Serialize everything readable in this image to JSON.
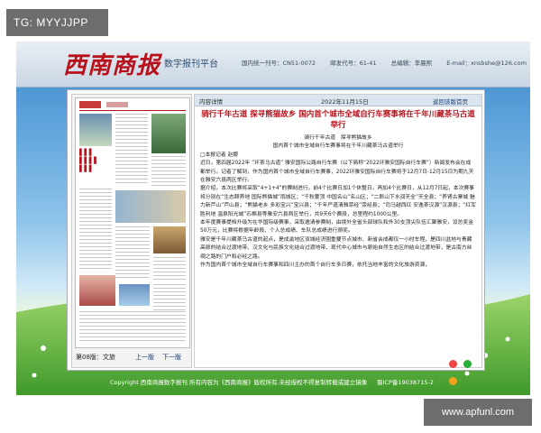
{
  "watermark_tag": "TG: MYYJJPP",
  "watermark_url": "www.apfunl.com",
  "header": {
    "logo": "西南商报",
    "platform": "数字报刊平台",
    "issn": "国内统一刊号：CN51-0072",
    "postal": "邮发代号：61-41",
    "editor": "总编辑：李晨熙",
    "email": "E-mail：xnsbshe@126.com"
  },
  "thumb": {
    "page_label": "第08版：文旅",
    "prev": "上一版",
    "next": "下一版"
  },
  "article": {
    "tab": "内容详情",
    "date": "2022年11月15日",
    "back": "返回该版首页",
    "title": "骑行千年古道 探寻熊猫故乡 国内首个城市全域自行车赛事将在千年川藏茶马古道举行",
    "subtitle1": "骑行千年古道　探寻熊猫故乡",
    "subtitle2": "国内首个城市全域自行车赛事将在千年川藏茶马古道举行",
    "byline": "□本报记者 赵娜",
    "paragraphs": [
      "近日，第四届2022年 “环茶马古道” 雅安国际公路自行车赛（以下简称“2022环雅安国际自行车赛”）新闻发布会在成都举行。记者了解到，作为国内首个城市全域自行车赛事，2022环雅安国际自行车赛将于12月7日-12月15日为期九天在雅安六县两区举行。",
      "据介绍，本次比赛将采取“4+1+4”的赛制进行，前4个比赛日加1个休整日，再加4个比赛日，从12月7日起，本次赛事将分别在“生态颐养地 国际熊猫城”雨城区；“千秋蒙顶 中国名山”名山区；“二郎山下水润天全”天全县；“养肾古寨城 魅力新芦山”芦山县；“熊猫老乡 多彩宝兴”宝兴县；“千年严道清雅荥经”荥经县；“司马越西红 安逸茶汉源”汉源县；“红军胜利地 温泉阳光城”石棉县等雅安六县两区举行，共9天6个赛段，总里程约1000公里。",
      "本年度赛事提档升级为在华国际级赛事，采取邀请参赛制，由境外全省头部球队和外30支顶尖队伍汇聚雅安，设总奖金50万元，比赛将根据年龄段、个人总成绩、车队总成绩进行颁奖。",
      "雅安是千年川藏茶马古道的起点，是成渝地区双城经济圈重要节点城市、新省会成都仅一小时车程，是四川盆地与青藏高原的结合过渡地带、汉文化与民族文化结合过渡地带、现代中心城市与原始自然生态区的结合过渡地带，是古南方丝绸之路的门户和必经之路。",
      "作为国内首个城市全域自行车赛事和四川主办的首个自行车多日赛，依托当地丰富的文化旅游资源，"
    ]
  },
  "footer": {
    "copyright": "Copyright 西南商报数字报刊",
    "rights": "所有内容为《西南商报》版权所有.未经授权不得复制转载或建立镜像",
    "icp": "蜀ICP备19038715-2"
  },
  "colors": {
    "title_red": "#b5121b",
    "logo_red": "#b8111a"
  }
}
